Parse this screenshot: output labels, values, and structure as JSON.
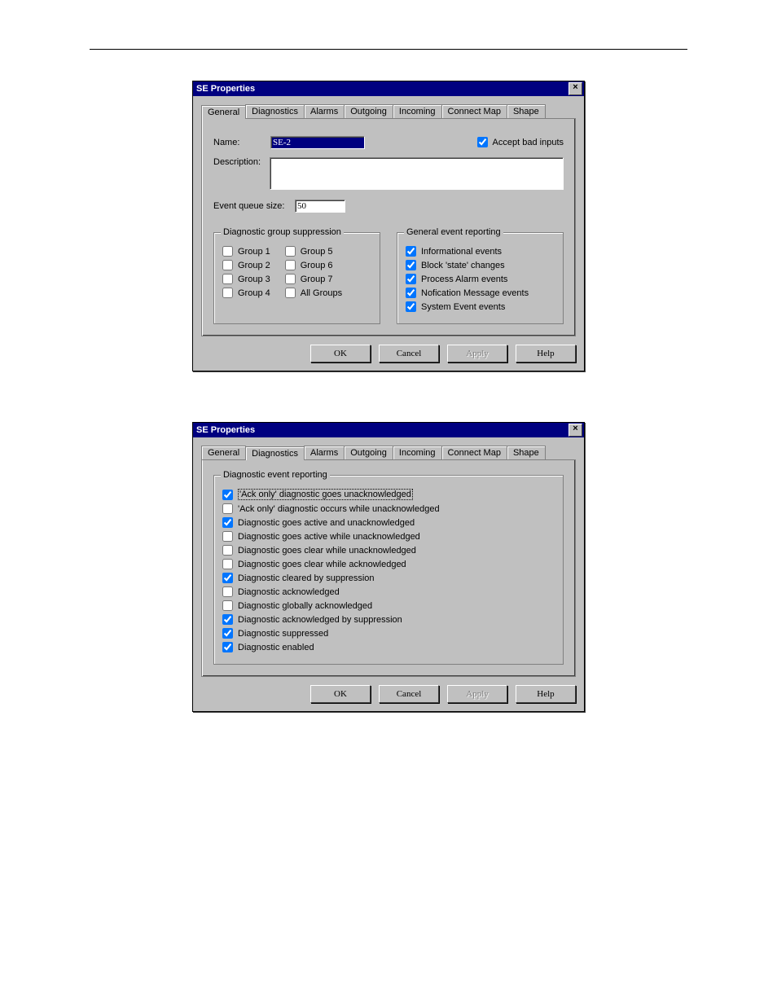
{
  "dialog1": {
    "title": "SE Properties",
    "close": "×",
    "tabs": [
      "General",
      "Diagnostics",
      "Alarms",
      "Outgoing",
      "Incoming",
      "Connect Map",
      "Shape"
    ],
    "activeTab": 0,
    "nameLabel": "Name:",
    "nameValue": "SE-2",
    "acceptBad": {
      "label": "Accept bad inputs",
      "checked": true
    },
    "descLabel": "Description:",
    "descValue": "",
    "queueLabel": "Event queue size:",
    "queueValue": "50",
    "suppression": {
      "legend": "Diagnostic group suppression",
      "left": [
        {
          "label": "Group 1",
          "checked": false
        },
        {
          "label": "Group 2",
          "checked": false
        },
        {
          "label": "Group 3",
          "checked": false
        },
        {
          "label": "Group 4",
          "checked": false
        }
      ],
      "right": [
        {
          "label": "Group 5",
          "checked": false
        },
        {
          "label": "Group 6",
          "checked": false
        },
        {
          "label": "Group 7",
          "checked": false
        },
        {
          "label": "All Groups",
          "checked": false
        }
      ]
    },
    "reporting": {
      "legend": "General event reporting",
      "items": [
        {
          "label": "Informational events",
          "checked": true
        },
        {
          "label": "Block 'state' changes",
          "checked": true
        },
        {
          "label": "Process Alarm events",
          "checked": true
        },
        {
          "label": "Nofication Message events",
          "checked": true
        },
        {
          "label": "System Event events",
          "checked": true
        }
      ]
    },
    "buttons": {
      "ok": "OK",
      "cancel": "Cancel",
      "apply": "Apply",
      "help": "Help"
    }
  },
  "dialog2": {
    "title": "SE Properties",
    "close": "×",
    "tabs": [
      "General",
      "Diagnostics",
      "Alarms",
      "Outgoing",
      "Incoming",
      "Connect Map",
      "Shape"
    ],
    "activeTab": 1,
    "diag": {
      "legend": "Diagnostic event reporting",
      "items": [
        {
          "label": "'Ack only' diagnostic goes unacknowledged",
          "checked": true,
          "hl": true
        },
        {
          "label": "'Ack only' diagnostic occurs while unacknowledged",
          "checked": false
        },
        {
          "label": "Diagnostic goes active and unacknowledged",
          "checked": true
        },
        {
          "label": "Diagnostic goes active while unacknowledged",
          "checked": false
        },
        {
          "label": "Diagnostic goes clear while unacknowledged",
          "checked": false
        },
        {
          "label": "Diagnostic goes clear while acknowledged",
          "checked": false
        },
        {
          "label": "Diagnostic cleared by suppression",
          "checked": true
        },
        {
          "label": "Diagnostic acknowledged",
          "checked": false
        },
        {
          "label": "Diagnostic globally acknowledged",
          "checked": false
        },
        {
          "label": "Diagnostic acknowledged by suppression",
          "checked": true
        },
        {
          "label": "Diagnostic suppressed",
          "checked": true
        },
        {
          "label": "Diagnostic enabled",
          "checked": true
        }
      ]
    },
    "buttons": {
      "ok": "OK",
      "cancel": "Cancel",
      "apply": "Apply",
      "help": "Help"
    }
  }
}
